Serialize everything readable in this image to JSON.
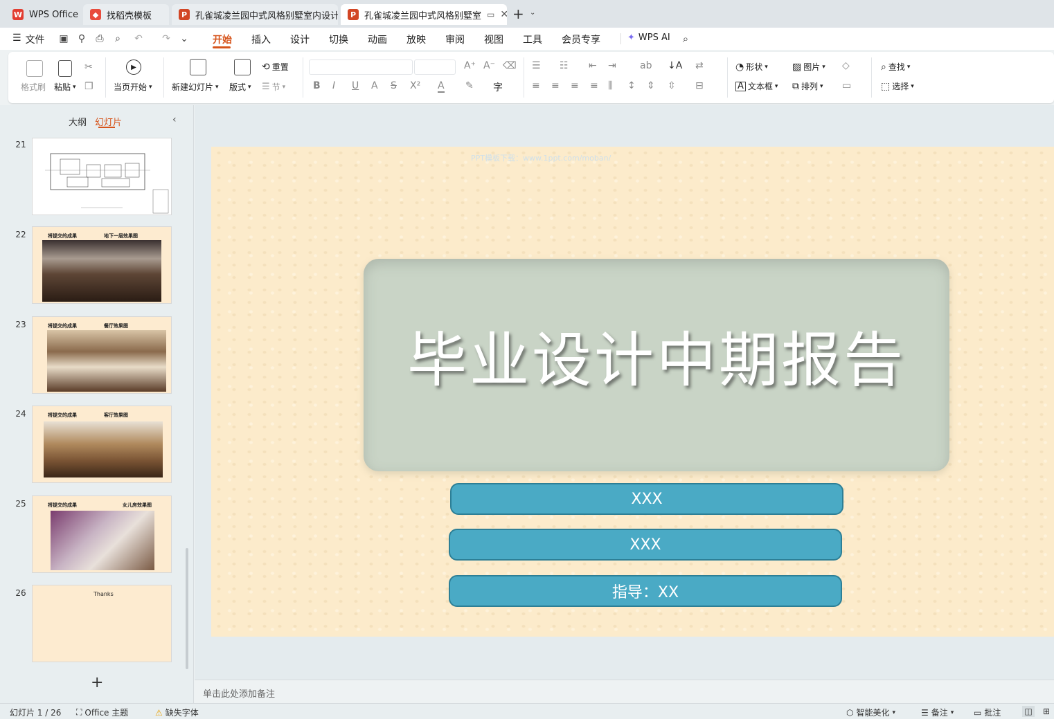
{
  "tabs": [
    {
      "label": "WPS Office",
      "icon": "wps-logo-icon"
    },
    {
      "label": "找稻壳模板",
      "icon": "docer-icon"
    },
    {
      "label": "孔雀城凌兰园中式风格别墅室内设计",
      "icon": "ppt-icon"
    },
    {
      "label": "孔雀城凌兰园中式风格别墅室",
      "icon": "ppt-icon"
    }
  ],
  "menu": {
    "file": "文件",
    "items": [
      "开始",
      "插入",
      "设计",
      "切换",
      "动画",
      "放映",
      "审阅",
      "视图",
      "工具",
      "会员专享"
    ],
    "active": "开始",
    "wps_ai": "WPS AI"
  },
  "ribbon": {
    "format_painter": "格式刷",
    "paste": "粘贴",
    "start_from_current": "当页开始",
    "new_slide": "新建幻灯片",
    "layout": "版式",
    "reset": "重置",
    "section": "节",
    "shape": "形状",
    "picture": "图片",
    "textbox": "文本框",
    "arrange": "排列",
    "find": "查找",
    "select": "选择"
  },
  "panel": {
    "outline_tab": "大纲",
    "slides_tab": "幻灯片"
  },
  "thumbnails": [
    {
      "num": "21",
      "caption_left": "",
      "caption_right": ""
    },
    {
      "num": "22",
      "caption_left": "将提交的成果",
      "caption_right": "地下一层效果图"
    },
    {
      "num": "23",
      "caption_left": "将提交的成果",
      "caption_right": "餐厅效果图"
    },
    {
      "num": "24",
      "caption_left": "将提交的成果",
      "caption_right": "客厅效果图"
    },
    {
      "num": "25",
      "caption_left": "将提交的成果",
      "caption_right": "女儿房效果图"
    },
    {
      "num": "26",
      "caption_left": "Thanks",
      "caption_right": ""
    }
  ],
  "slide": {
    "watermark": "PPT模板下载：www.1ppt.com/moban/",
    "title": "毕业设计中期报告",
    "line1": "XXX",
    "line2": "XXX",
    "line3": "指导：XX"
  },
  "notes_placeholder": "单击此处添加备注",
  "status": {
    "slide_counter": "幻灯片 1 / 26",
    "theme": "Office 主题",
    "missing_font": "缺失字体",
    "smart_beautify": "智能美化",
    "notes": "备注",
    "comments": "批注"
  },
  "colors": {
    "accent": "#d6541b",
    "pill": "#4aaac5",
    "slide_bg": "#fcebcb"
  }
}
